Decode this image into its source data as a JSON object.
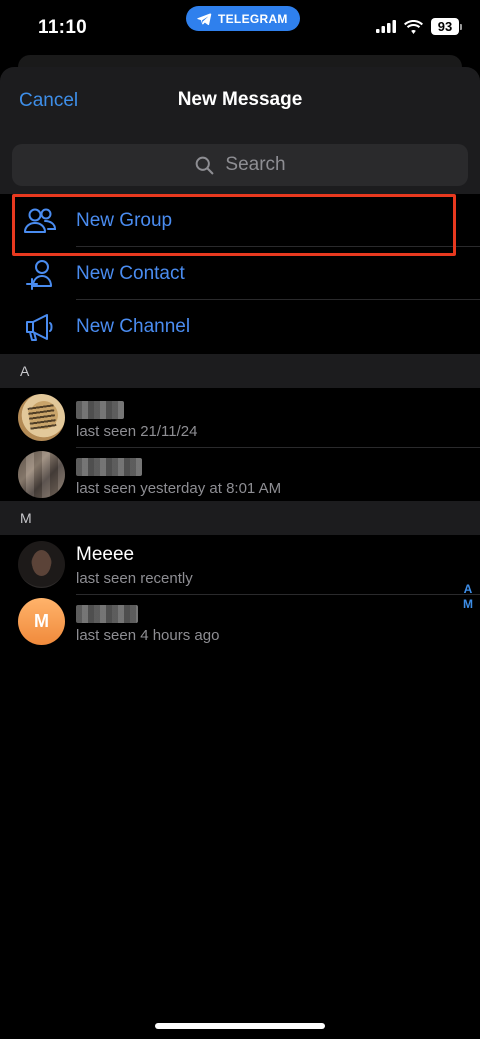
{
  "status_bar": {
    "time": "11:10",
    "pill_label": "TELEGRAM",
    "battery": "93"
  },
  "header": {
    "cancel_label": "Cancel",
    "title": "New Message"
  },
  "search": {
    "placeholder": "Search"
  },
  "actions": [
    {
      "label": "New Group",
      "icon": "group-icon"
    },
    {
      "label": "New Contact",
      "icon": "add-contact-icon"
    },
    {
      "label": "New Channel",
      "icon": "megaphone-icon"
    }
  ],
  "sections": [
    {
      "letter": "A",
      "contacts": [
        {
          "name": "",
          "status": "last seen 21/11/24"
        },
        {
          "name": "",
          "status": "last seen yesterday at 8:01 AM"
        }
      ]
    },
    {
      "letter": "M",
      "contacts": [
        {
          "name": "Meeee",
          "status": "last seen recently"
        },
        {
          "name": "",
          "status": "last seen 4 hours ago",
          "initial": "M"
        }
      ]
    }
  ],
  "index_letters": [
    "A",
    "M"
  ],
  "colors": {
    "accent": "#3e8ee8",
    "action_text": "#4a8cf0",
    "highlight": "#e8391f",
    "pill": "#2f80ed"
  }
}
